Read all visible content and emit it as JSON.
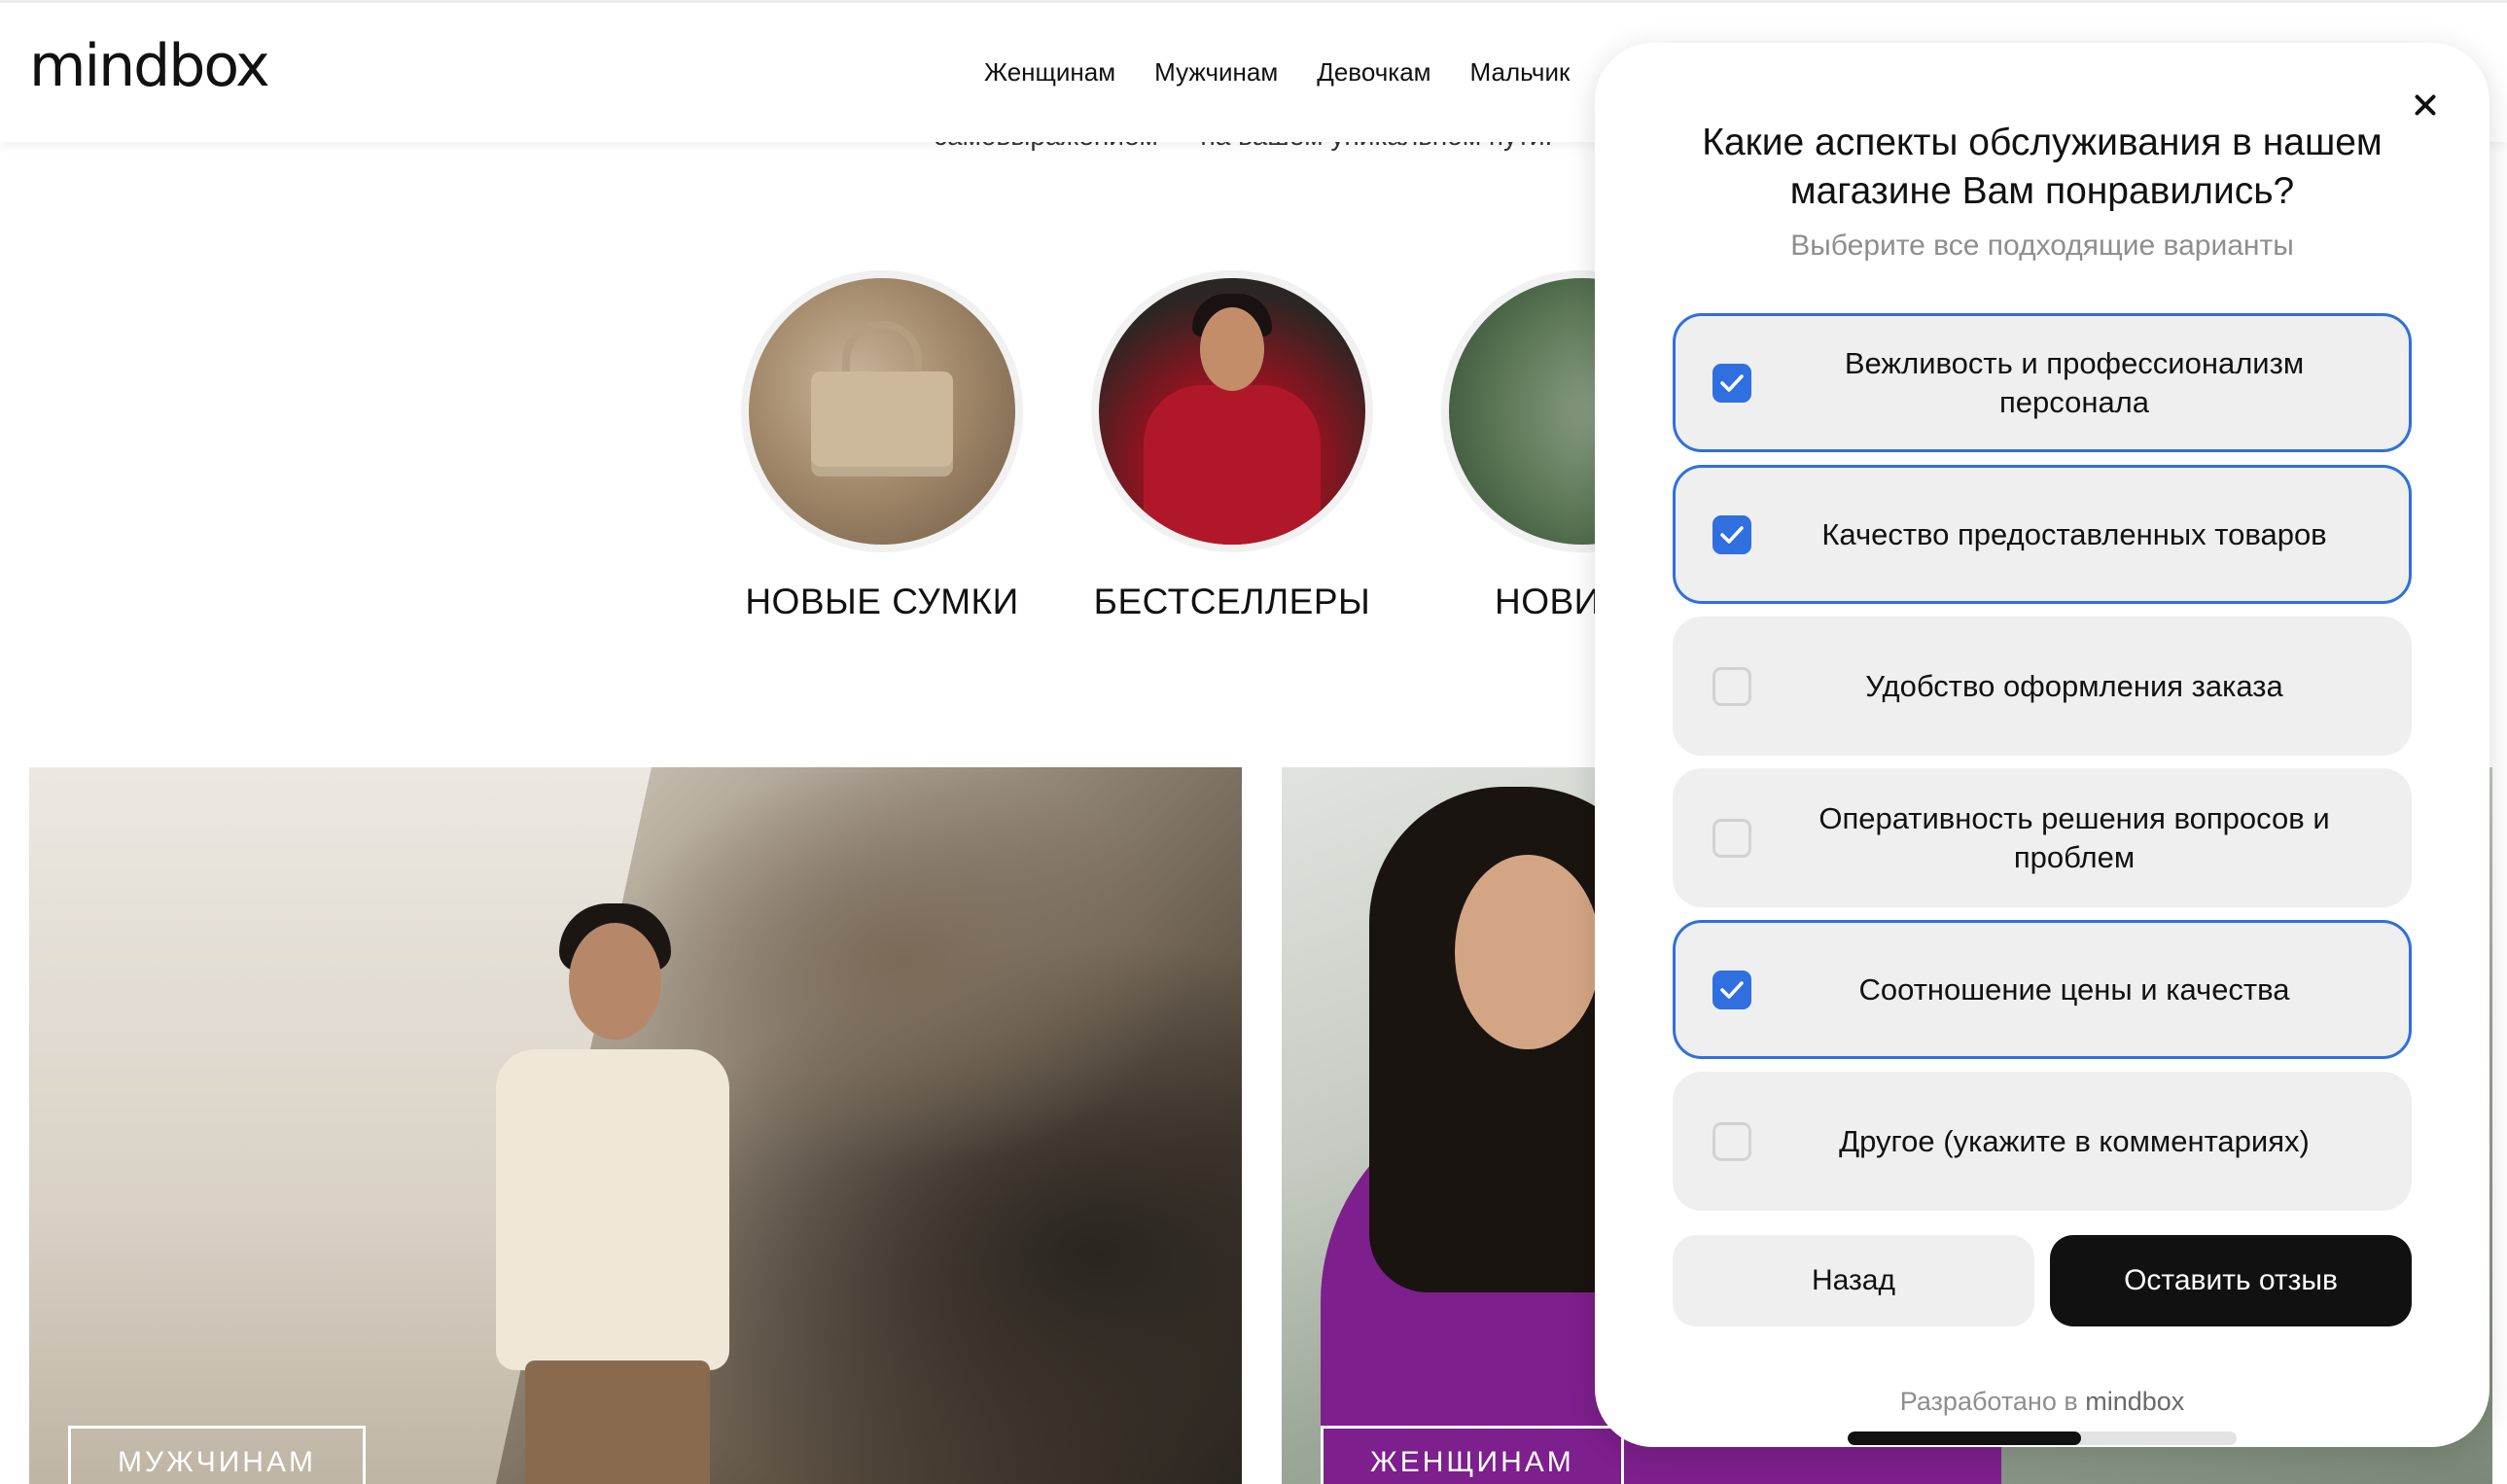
{
  "header": {
    "logo": "mindbox",
    "nav": [
      "Женщинам",
      "Мужчинам",
      "Девочкам",
      "Мальчик"
    ]
  },
  "hidden_tagline": "самовыражением — на вашем уникальном пути.",
  "categories": [
    {
      "label": "НОВЫЕ СУМКИ"
    },
    {
      "label": "БЕСТСЕЛЛЕРЫ"
    },
    {
      "label": "НОВИ"
    }
  ],
  "banners": {
    "left_button": "МУЖЧИНАМ",
    "right_button": "ЖЕНЩИНАМ"
  },
  "modal": {
    "title": "Какие аспекты обслуживания в нашем магазине Вам понравились?",
    "subtitle": "Выберите все подходящие варианты",
    "options": [
      {
        "label": "Вежливость и профессионализм персонала",
        "checked": true
      },
      {
        "label": "Качество предоставленных товаров",
        "checked": true
      },
      {
        "label": "Удобство оформления заказа",
        "checked": false
      },
      {
        "label": "Оперативность решения вопросов и проблем",
        "checked": false
      },
      {
        "label": "Соотношение цены и качества",
        "checked": true
      },
      {
        "label": "Другое (укажите в комментариях)",
        "checked": false
      }
    ],
    "back_label": "Назад",
    "submit_label": "Оставить отзыв",
    "powered_prefix": "Разработано в",
    "powered_brand": "mindbox",
    "progress_fraction": 0.6
  },
  "colors": {
    "accent": "#2f6fe0",
    "submit_bg": "#111111",
    "option_bg": "#efefef"
  },
  "icons": {
    "close": "close-icon",
    "check": "checkmark-icon"
  }
}
